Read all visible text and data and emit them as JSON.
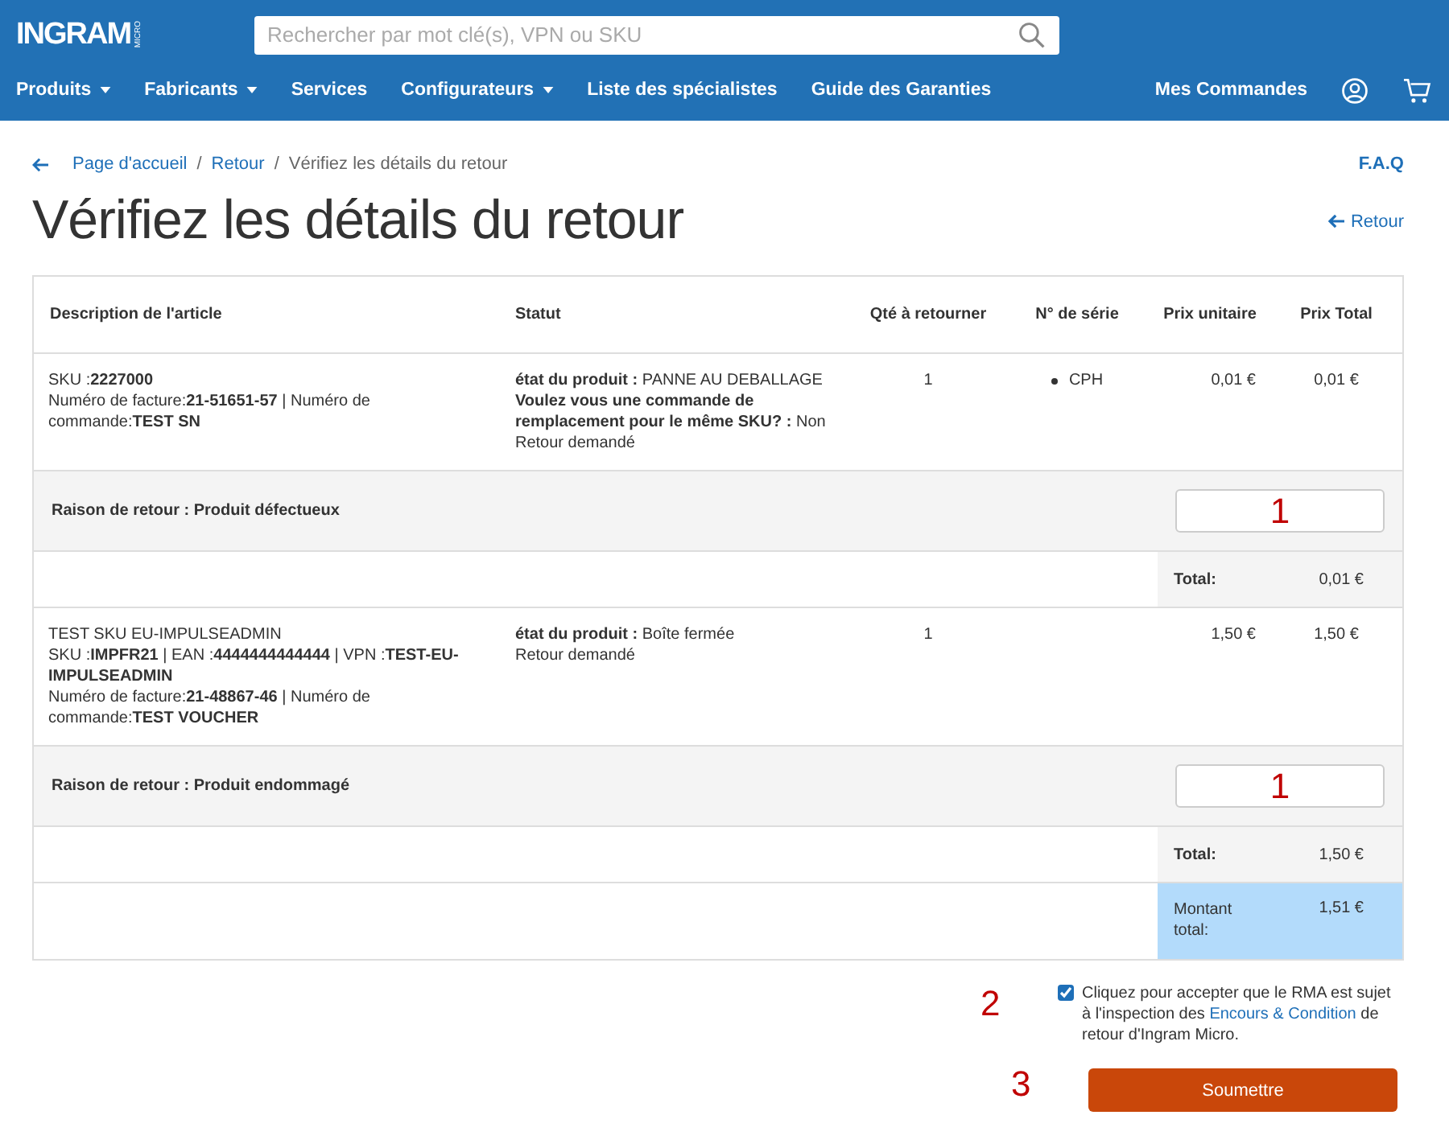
{
  "header": {
    "logo": "INGRAM",
    "logo_sub": "MICRO",
    "search": {
      "placeholder": "Rechercher par mot clé(s), VPN ou SKU"
    },
    "nav": [
      {
        "label": "Produits",
        "dropdown": true
      },
      {
        "label": "Fabricants",
        "dropdown": true
      },
      {
        "label": "Services",
        "dropdown": false
      },
      {
        "label": "Configurateurs",
        "dropdown": true
      },
      {
        "label": "Liste des spécialistes",
        "dropdown": false
      },
      {
        "label": "Guide des Garanties",
        "dropdown": false
      }
    ],
    "orders_link": "Mes Commandes"
  },
  "breadcrumb": {
    "items": [
      {
        "label": "Page d'accueil",
        "separator": "/"
      },
      {
        "label": "Retour",
        "separator": "/"
      }
    ],
    "current": "Vérifiez les détails du retour"
  },
  "faq": "F.A.Q",
  "title": "Vérifiez les détails du retour",
  "back_link": "Retour",
  "table": {
    "columns": [
      "Description de l'article",
      "Statut",
      "Qté à retourner",
      "N° de série",
      "Prix unitaire",
      "Prix Total"
    ],
    "groups": [
      {
        "description": [
          "SKU :**2227000**",
          "Numéro de facture:**21-51651-57** |  Numéro de commande:**TEST SN**"
        ],
        "status": [
          "**état du produit :** PANNE AU DEBALLAGE",
          "**Voulez vous une commande de remplacement pour le même SKU? :** Non",
          "Retour demandé"
        ],
        "quantity": "1",
        "serials": [
          "CPH"
        ],
        "unit_price": "0,01 €",
        "total_price": "0,01 €",
        "reason": "Raison de retour : Produit défectueux",
        "reason_field": "1",
        "total_label": "Total:",
        "total": "0,01 €"
      },
      {
        "description": [
          "TEST SKU EU-IMPULSEADMIN",
          "SKU :**IMPFR21** | EAN :**4444444444444** | VPN :**TEST-EU-IMPULSEADMIN**",
          "Numéro de facture:**21-48867-46** |  Numéro de commande:**TEST VOUCHER**"
        ],
        "status": [
          "**état du produit :** Boîte fermée",
          "Retour demandé"
        ],
        "quantity": "1",
        "unit_price": "1,50 €",
        "total_price": "1,50 €",
        "reason": "Raison de retour : Produit endommagé",
        "reason_field": "1",
        "total_label": "Total:",
        "total": "1,50 €"
      }
    ],
    "grand_total_label": "Montant total:",
    "grand_total": "1,51 €"
  },
  "agreement": {
    "marker": "2",
    "checked": true,
    "text": "Cliquez pour accepter que le RMA est sujet à l'inspection des",
    "link": "Encours & Condition",
    "text_after": "de retour d'Ingram Micro."
  },
  "submit": {
    "marker": "3",
    "label": "Soumettre"
  }
}
